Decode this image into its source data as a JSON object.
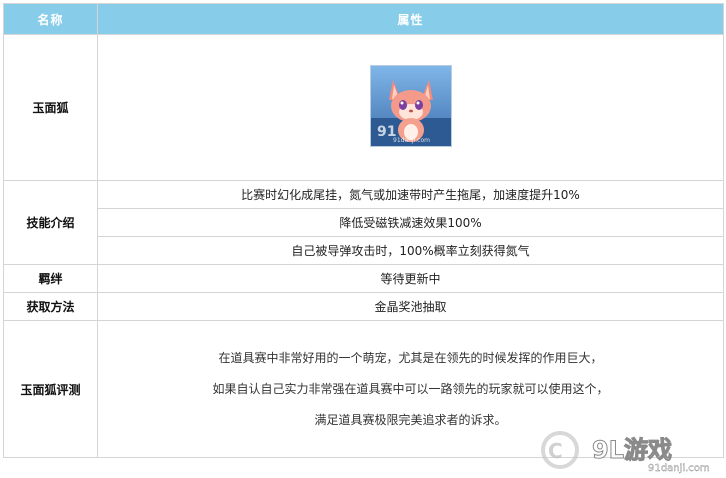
{
  "table": {
    "header": {
      "col_name": "名称",
      "col_attr": "属性"
    },
    "pet": {
      "name": "玉面狐",
      "image_alt": "玉面狐",
      "image_watermark": "91",
      "image_watermark_sub": "91danji.com"
    },
    "skills": {
      "label": "技能介绍",
      "items": [
        "比赛时幻化成尾挂，氮气或加速带时产生拖尾，加速度提升10%",
        "降低受磁铁减速效果100%",
        "自己被导弹攻击时，100%概率立刻获得氮气"
      ]
    },
    "bond": {
      "label": "羁绊",
      "value": "等待更新中"
    },
    "obtain": {
      "label": "获取方法",
      "value": "金晶奖池抽取"
    },
    "review": {
      "label": "玉面狐评测",
      "lines": [
        "在道具赛中非常好用的一个萌宠，尤其是在领先的时候发挥的作用巨大，",
        "如果自认自己实力非常强在道具赛中可以一路领先的玩家就可以使用这个，",
        "满足道具赛极限完美追求者的诉求。"
      ]
    }
  },
  "watermark": {
    "logo": "9L游戏",
    "url": "91danji.com"
  }
}
